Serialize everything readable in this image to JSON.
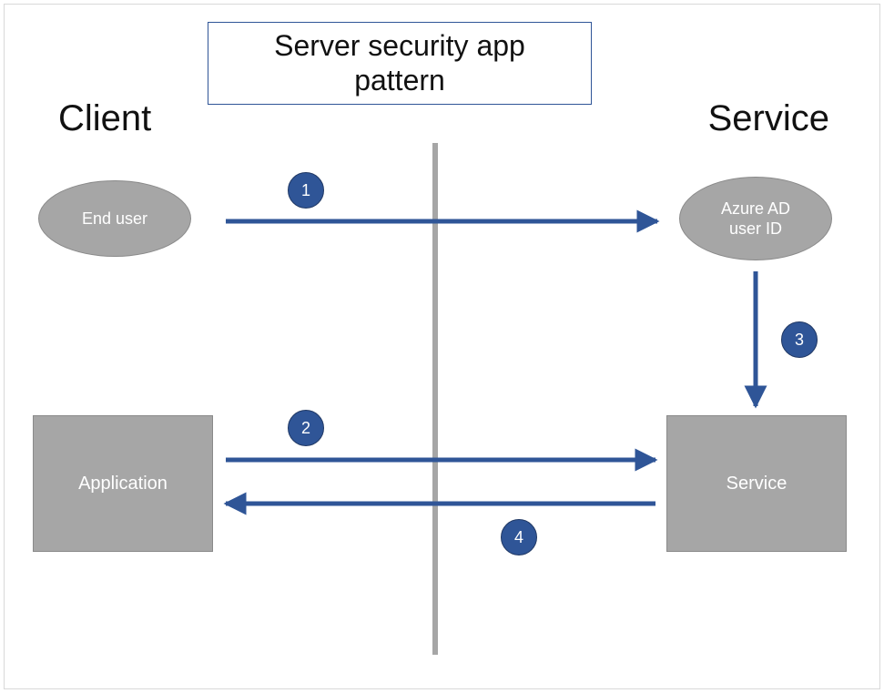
{
  "title": "Server security app pattern",
  "sections": {
    "left_heading": "Client",
    "right_heading": "Service"
  },
  "nodes": {
    "end_user": "End user",
    "azure_ad": "Azure AD\nuser ID",
    "application": "Application",
    "service": "Service"
  },
  "steps": {
    "s1": "1",
    "s2": "2",
    "s3": "3",
    "s4": "4"
  },
  "colors": {
    "node_fill": "#a6a6a6",
    "arrow": "#2f5597",
    "badge_fill": "#2f5597",
    "badge_border": "#203864"
  }
}
